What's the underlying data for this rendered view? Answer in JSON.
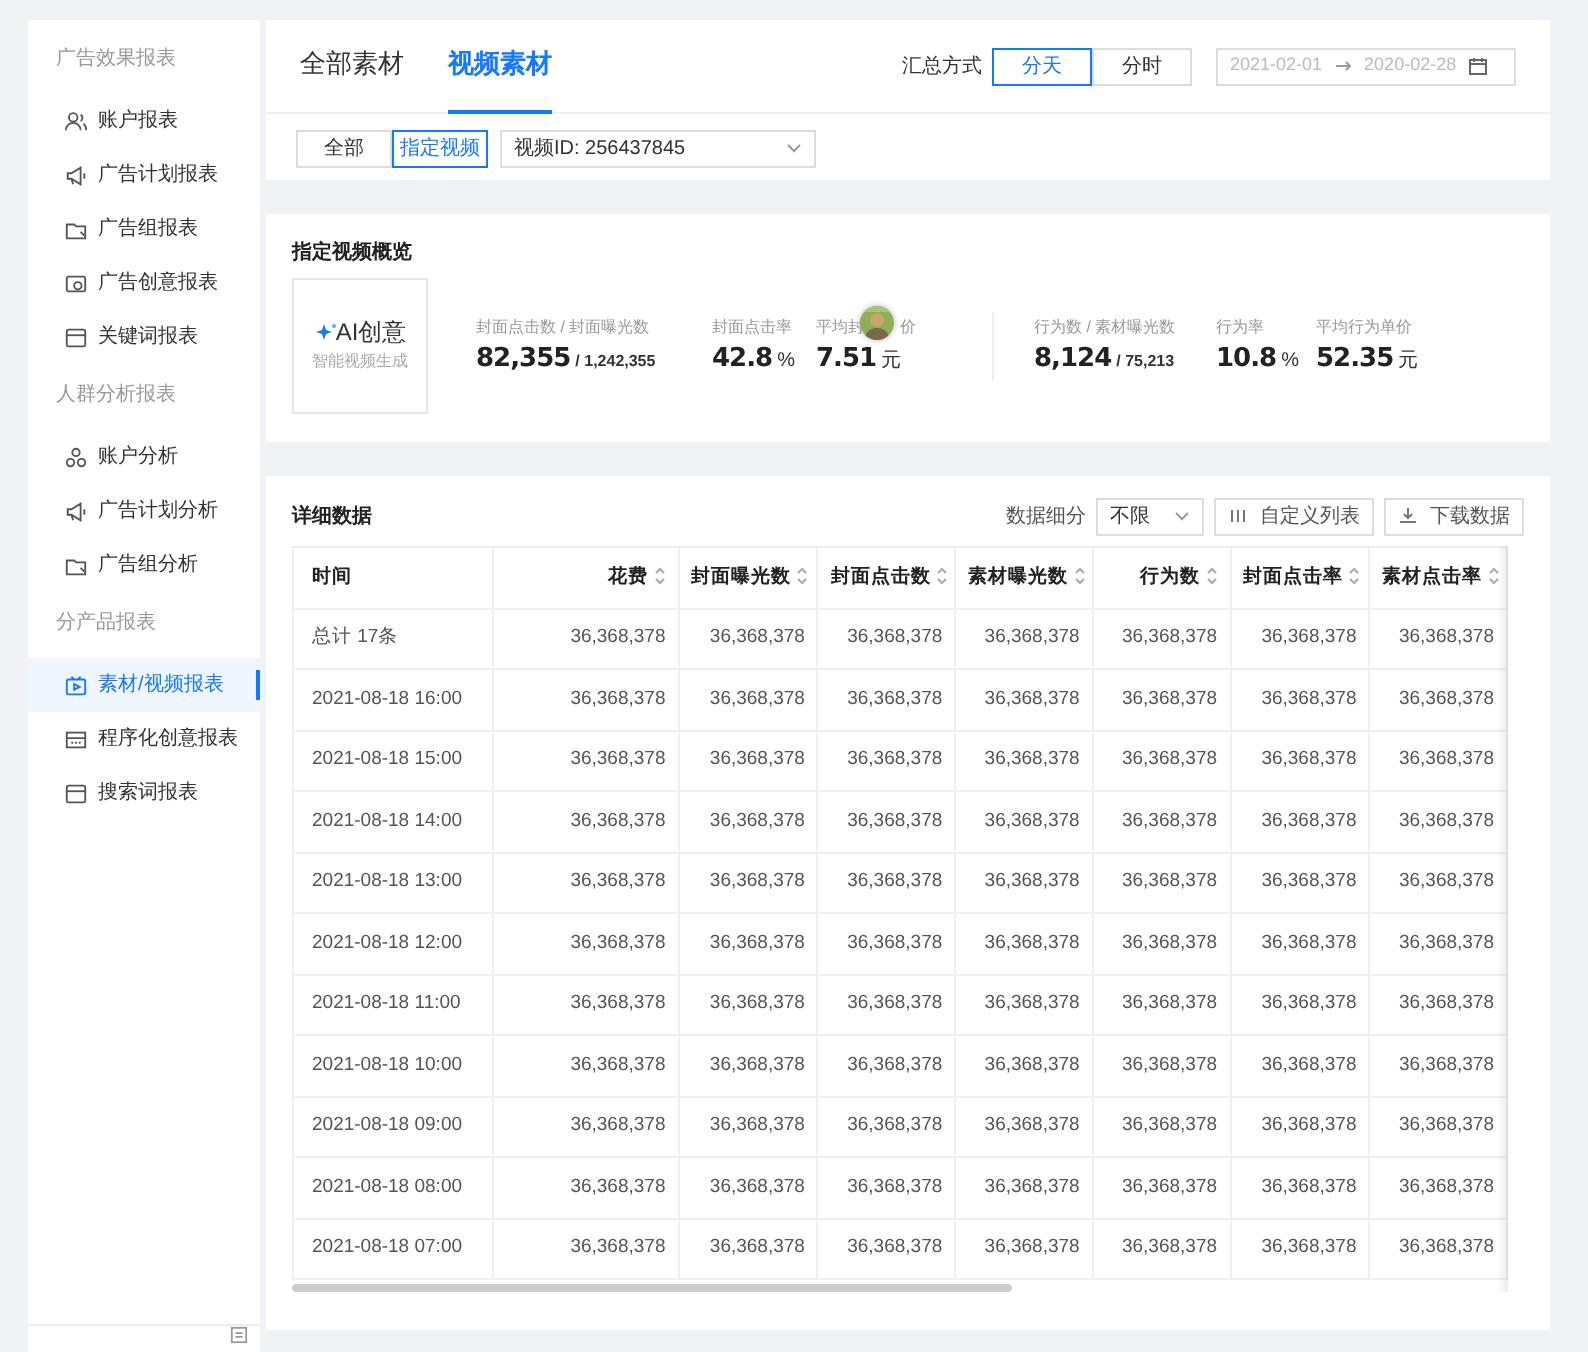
{
  "sidebar": {
    "groups": [
      {
        "title": "广告效果报表",
        "items": [
          {
            "label": "账户报表",
            "selected": false
          },
          {
            "label": "广告计划报表",
            "selected": false
          },
          {
            "label": "广告组报表",
            "selected": false
          },
          {
            "label": "广告创意报表",
            "selected": false
          },
          {
            "label": "关键词报表",
            "selected": false
          }
        ]
      },
      {
        "title": "人群分析报表",
        "items": [
          {
            "label": "账户分析",
            "selected": false
          },
          {
            "label": "广告计划分析",
            "selected": false
          },
          {
            "label": "广告组分析",
            "selected": false
          }
        ]
      },
      {
        "title": "分产品报表",
        "items": [
          {
            "label": "素材/视频报表",
            "selected": true
          },
          {
            "label": "程序化创意报表",
            "selected": false
          },
          {
            "label": "搜索词报表",
            "selected": false
          }
        ]
      }
    ]
  },
  "tabs": [
    {
      "label": "全部素材",
      "selected": false
    },
    {
      "label": "视频素材",
      "selected": true
    }
  ],
  "summary": {
    "label": "汇总方式",
    "options": [
      {
        "label": "分天",
        "selected": true
      },
      {
        "label": "分时",
        "selected": false
      }
    ]
  },
  "date_range": {
    "start": "2021-02-01",
    "end": "2020-02-28"
  },
  "filter": {
    "options": [
      {
        "label": "全部",
        "selected": false
      },
      {
        "label": "指定视频",
        "selected": true
      }
    ],
    "video_select": "视频ID: 256437845"
  },
  "overview": {
    "title": "指定视频概览",
    "ai": {
      "title": "AI创意",
      "subtitle": "智能视频生成"
    },
    "stats": [
      {
        "label": "封面点击数 / 封面曝光数",
        "value": "82,355",
        "sub": "/ 1,242,355"
      },
      {
        "label": "封面点击率",
        "value": "42.8",
        "unit": "%"
      },
      {
        "label": "平均封",
        "label_tail": "价",
        "value": "7.51",
        "unit": "元"
      },
      {
        "label": "行为数 / 素材曝光数",
        "value": "8,124",
        "sub": "/ 75,213"
      },
      {
        "label": "行为率",
        "value": "10.8",
        "unit": "%"
      },
      {
        "label": "平均行为单价",
        "value": "52.35",
        "unit": "元"
      }
    ]
  },
  "details": {
    "title": "详细数据",
    "breakdown_label": "数据细分",
    "breakdown": "不限",
    "buttons": [
      {
        "label": "自定义列表"
      },
      {
        "label": "下载数据"
      }
    ],
    "table": {
      "columns": [
        "时间",
        "花费",
        "封面曝光数",
        "封面点击数",
        "素材曝光数",
        "行为数",
        "封面点击率",
        "素材点击率"
      ],
      "rows": [
        [
          "总计  17条",
          "36,368,378",
          "36,368,378",
          "36,368,378",
          "36,368,378",
          "36,368,378",
          "36,368,378",
          "36,368,378"
        ],
        [
          "2021-08-18 16:00",
          "36,368,378",
          "36,368,378",
          "36,368,378",
          "36,368,378",
          "36,368,378",
          "36,368,378",
          "36,368,378"
        ],
        [
          "2021-08-18 15:00",
          "36,368,378",
          "36,368,378",
          "36,368,378",
          "36,368,378",
          "36,368,378",
          "36,368,378",
          "36,368,378"
        ],
        [
          "2021-08-18 14:00",
          "36,368,378",
          "36,368,378",
          "36,368,378",
          "36,368,378",
          "36,368,378",
          "36,368,378",
          "36,368,378"
        ],
        [
          "2021-08-18 13:00",
          "36,368,378",
          "36,368,378",
          "36,368,378",
          "36,368,378",
          "36,368,378",
          "36,368,378",
          "36,368,378"
        ],
        [
          "2021-08-18 12:00",
          "36,368,378",
          "36,368,378",
          "36,368,378",
          "36,368,378",
          "36,368,378",
          "36,368,378",
          "36,368,378"
        ],
        [
          "2021-08-18 11:00",
          "36,368,378",
          "36,368,378",
          "36,368,378",
          "36,368,378",
          "36,368,378",
          "36,368,378",
          "36,368,378"
        ],
        [
          "2021-08-18 10:00",
          "36,368,378",
          "36,368,378",
          "36,368,378",
          "36,368,378",
          "36,368,378",
          "36,368,378",
          "36,368,378"
        ],
        [
          "2021-08-18 09:00",
          "36,368,378",
          "36,368,378",
          "36,368,378",
          "36,368,378",
          "36,368,378",
          "36,368,378",
          "36,368,378"
        ],
        [
          "2021-08-18 08:00",
          "36,368,378",
          "36,368,378",
          "36,368,378",
          "36,368,378",
          "36,368,378",
          "36,368,378",
          "36,368,378"
        ],
        [
          "2021-08-18 07:00",
          "36,368,378",
          "36,368,378",
          "36,368,378",
          "36,368,378",
          "36,368,378",
          "36,368,378",
          "36,368,378"
        ]
      ]
    }
  }
}
